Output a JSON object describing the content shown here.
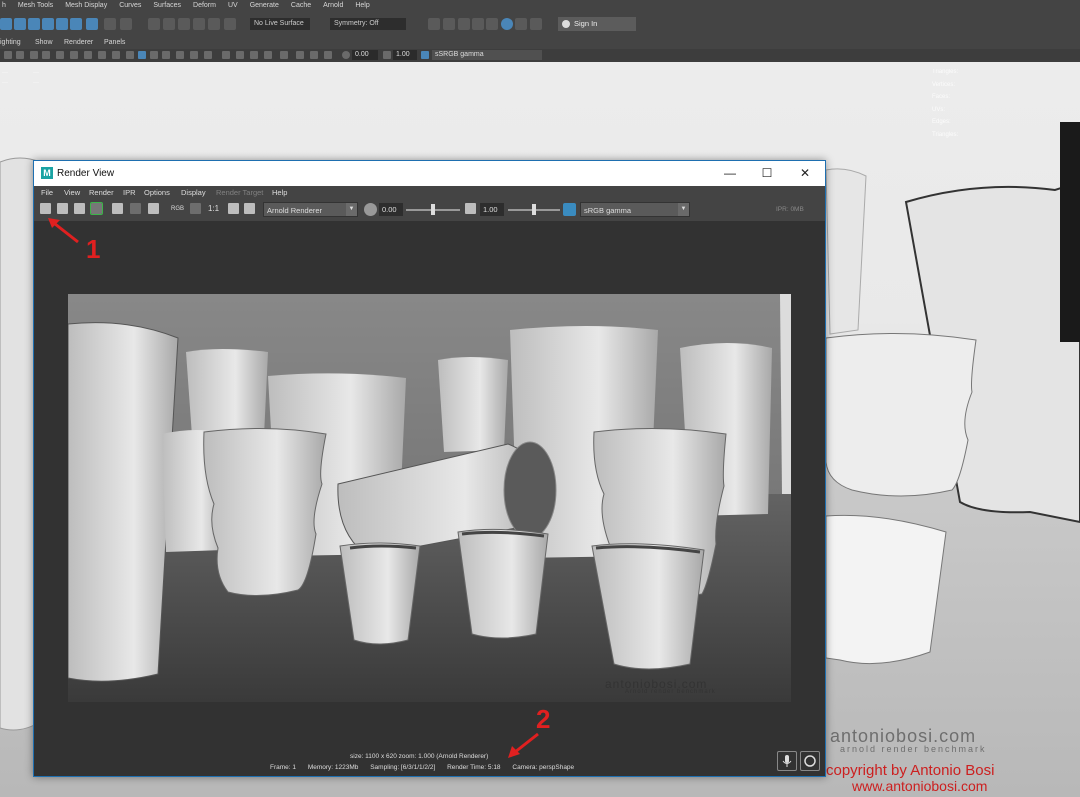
{
  "maya": {
    "menus": [
      "h",
      "Mesh Tools",
      "Mesh Display",
      "Curves",
      "Surfaces",
      "Deform",
      "UV",
      "Generate",
      "Cache",
      "Arnold",
      "Help"
    ],
    "live_surface": "No Live Surface",
    "symmetry": "Symmetry: Off",
    "sign_in": "Sign In",
    "panel_menus": [
      "ighting",
      "Show",
      "Renderer",
      "Panels"
    ],
    "exposure": "0.00",
    "gamma": "1.00",
    "color_space": "sSRGB gamma"
  },
  "viewport": {
    "hud_right": [
      "Triangles:",
      "Vertices:",
      "Faces:",
      "UVs:",
      "Edges:",
      "Triangles:",
      "Selected Edges:",
      "Selected Objects:"
    ],
    "watermark": "antoniobosi.com",
    "watermark_sub": "arnold render benchmark",
    "copyright": "copyright by Antonio Bosi",
    "url": "www.antoniobosi.com"
  },
  "render_view": {
    "title": "Render View",
    "logo": "M",
    "menus": [
      {
        "label": "File",
        "enabled": true
      },
      {
        "label": "View",
        "enabled": true
      },
      {
        "label": "Render",
        "enabled": true
      },
      {
        "label": "IPR",
        "enabled": true
      },
      {
        "label": "Options",
        "enabled": true
      },
      {
        "label": "Display",
        "enabled": true
      },
      {
        "label": "Render Target",
        "enabled": false
      },
      {
        "label": "Help",
        "enabled": true
      }
    ],
    "toolbar": {
      "rgb": "RGB",
      "ratio": "1:1",
      "renderer": "Arnold Renderer",
      "exposure": "0.00",
      "gamma": "1.00",
      "color_space": "sRGB gamma",
      "ipr": "IPR: 0MB"
    },
    "image": {
      "watermark": "antoniobosi.com",
      "watermark_sub": "Arnold render benchmark"
    },
    "info": {
      "line1": "size: 1100 x 620 zoom: 1.000      (Arnold Renderer)",
      "frame": "Frame: 1",
      "memory": "Memory: 1223Mb",
      "sampling": "Sampling: [6/3/1/1/2/2]",
      "render_time": "Render Time: 5:18",
      "camera": "Camera: perspShape"
    }
  },
  "annotations": {
    "one": "1",
    "two": "2"
  },
  "colors": {
    "accent": "#1e6fb0",
    "annotation": "#e02020"
  }
}
